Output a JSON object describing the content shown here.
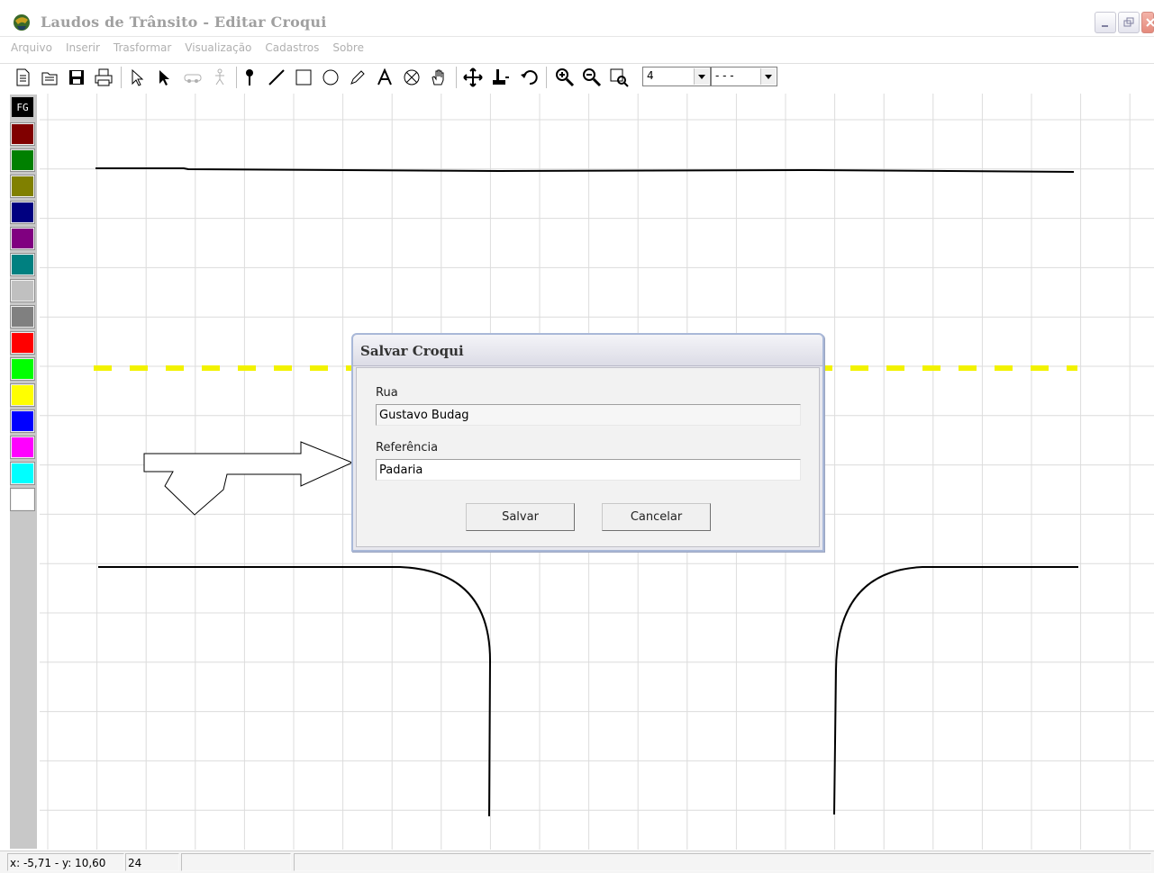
{
  "window": {
    "title": "Laudos de Trânsito - Editar Croqui",
    "controls": [
      "minimize-icon",
      "restore-icon",
      "close-icon"
    ]
  },
  "menu": {
    "items": [
      "Arquivo",
      "Inserir",
      "Trasformar",
      "Visualização",
      "Cadastros",
      "Sobre"
    ]
  },
  "toolbar": {
    "buttons": [
      "new-file-icon",
      "open-file-icon",
      "save-icon",
      "print-icon",
      "select-outline-icon",
      "select-arrow-icon",
      "car-icon",
      "pedestrian-icon",
      "pin-icon",
      "line-icon",
      "rectangle-icon",
      "ellipse-icon",
      "pencil-icon",
      "text-icon",
      "cross-circle-icon",
      "hand-icon",
      "move-icon",
      "anchor-icon",
      "rotate-icon",
      "zoom-in-icon",
      "zoom-out-icon",
      "zoom-window-icon"
    ],
    "line_width_value": "4",
    "line_style_value": "- - -"
  },
  "palette": {
    "fg_label": "FG",
    "colors": [
      "#800000",
      "#008000",
      "#808000",
      "#000080",
      "#800080",
      "#008080",
      "#c0c0c0",
      "#808080",
      "#ff0000",
      "#00ff00",
      "#ffff00",
      "#0000ff",
      "#ff00ff",
      "#00ffff",
      "#ffffff"
    ]
  },
  "canvas": {
    "grid_color": "#dcdcdc",
    "center_line_color": "#f2f200",
    "stroke_color": "#000000"
  },
  "dialog": {
    "title": "Salvar Croqui",
    "rua_label": "Rua",
    "rua_value": "Gustavo Budag",
    "referencia_label": "Referência",
    "referencia_value": "Padaria",
    "save_label": "Salvar",
    "cancel_label": "Cancelar"
  },
  "statusbar": {
    "coords": "x: -5,71  -  y: 10,60",
    "value": "24"
  }
}
